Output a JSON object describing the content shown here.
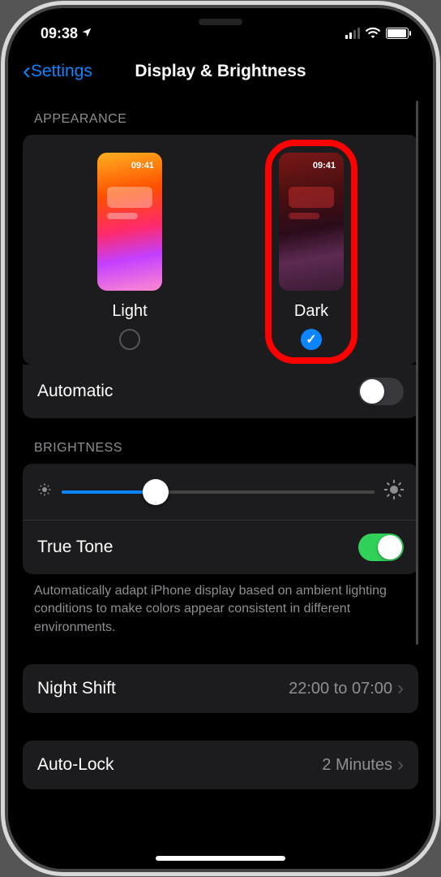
{
  "status": {
    "time": "09:38"
  },
  "nav": {
    "back": "Settings",
    "title": "Display & Brightness"
  },
  "appearance": {
    "header": "APPEARANCE",
    "light": {
      "label": "Light",
      "thumb_time": "09:41",
      "selected": false
    },
    "dark": {
      "label": "Dark",
      "thumb_time": "09:41",
      "selected": true
    },
    "automatic_label": "Automatic",
    "automatic_on": false
  },
  "brightness": {
    "header": "BRIGHTNESS",
    "value_pct": 30,
    "true_tone_label": "True Tone",
    "true_tone_on": true,
    "footnote": "Automatically adapt iPhone display based on ambient lighting conditions to make colors appear consistent in different environments."
  },
  "night_shift": {
    "label": "Night Shift",
    "value": "22:00 to 07:00"
  },
  "auto_lock": {
    "label": "Auto-Lock",
    "value": "2 Minutes"
  }
}
